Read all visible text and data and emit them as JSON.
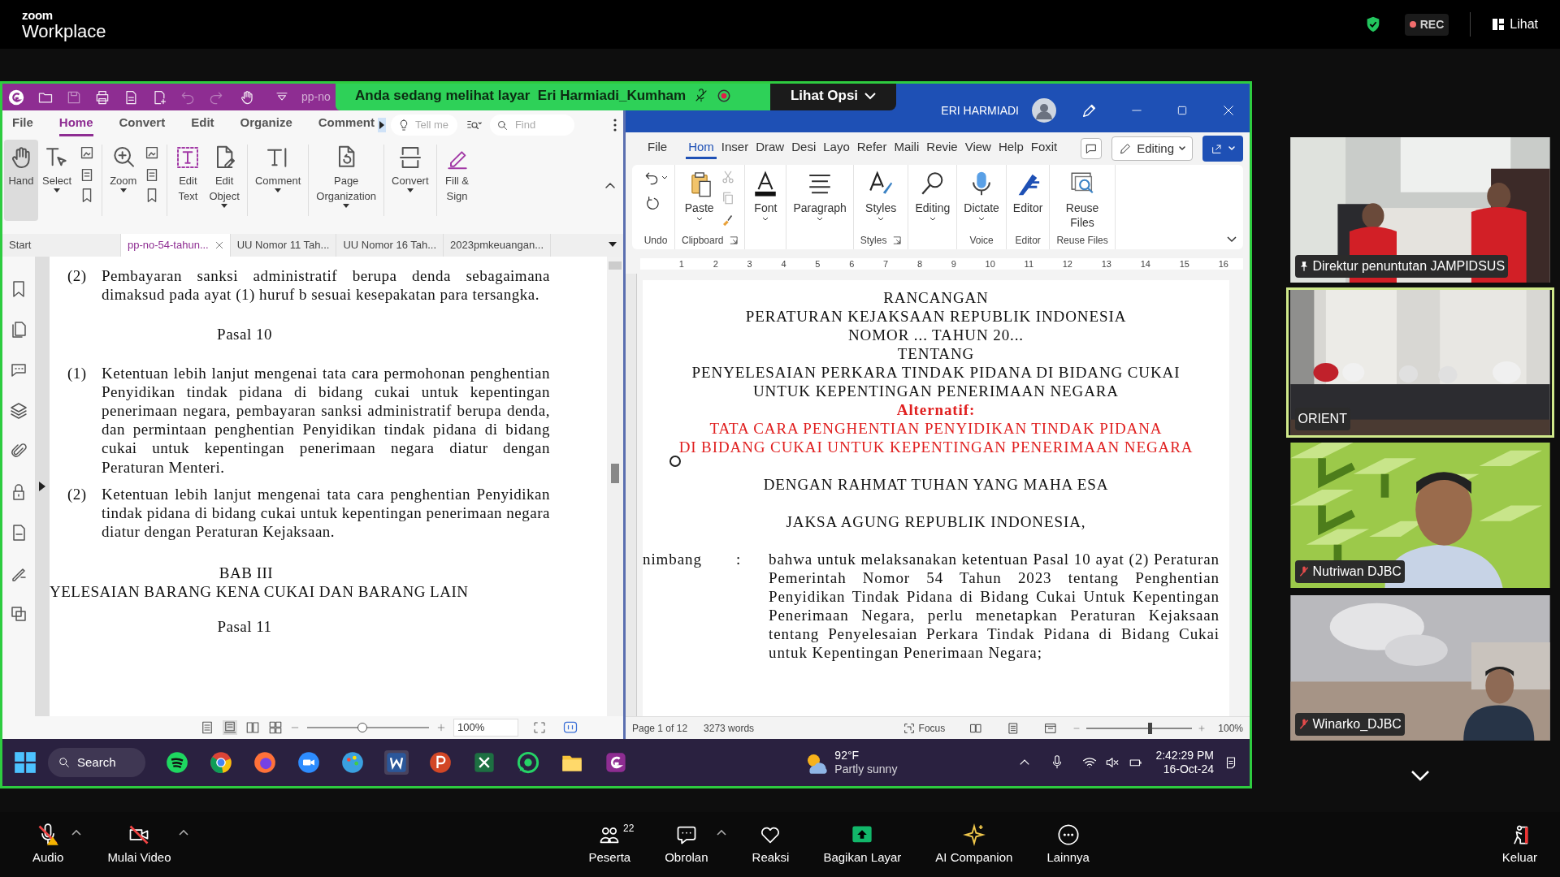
{
  "zoom_header": {
    "logo_top": "zoom",
    "logo_bottom": "Workplace",
    "rec": "REC",
    "view": "Lihat"
  },
  "share_banner": {
    "text": "Anda sedang melihat layar  Eri Harmiadi_Kumham",
    "options": "Lihat Opsi"
  },
  "foxit": {
    "title_fragment": "pp-no",
    "menu": [
      {
        "label": "File",
        "selected": false
      },
      {
        "label": "Home",
        "selected": true
      },
      {
        "label": "Convert",
        "selected": false
      },
      {
        "label": "Edit",
        "selected": false
      },
      {
        "label": "Organize",
        "selected": false
      },
      {
        "label": "Comment",
        "selected": false
      }
    ],
    "tell_me": "Tell me",
    "find": "Find",
    "ribbon": [
      {
        "kind": "big",
        "label": "Hand",
        "selected": true
      },
      {
        "kind": "big",
        "label": "Select",
        "caret": true,
        "selected": false
      },
      {
        "kind": "icon-stack"
      },
      {
        "kind": "big",
        "label": "Zoom",
        "caret": true,
        "selected": false
      },
      {
        "kind": "icon-stack"
      },
      {
        "kind": "big",
        "label": "Edit\nText",
        "selected": false
      },
      {
        "kind": "big",
        "label": "Edit\nObject",
        "caret": true,
        "selected": false
      },
      {
        "kind": "big",
        "label": "Comment",
        "caret": true,
        "selected": false
      },
      {
        "kind": "big",
        "label": "Page\nOrganization",
        "caret": true,
        "selected": false
      },
      {
        "kind": "big",
        "label": "Convert",
        "caret": true,
        "selected": false
      },
      {
        "kind": "big",
        "label": "Fill &\nSign",
        "selected": false
      }
    ],
    "tabs": [
      {
        "label": "Start",
        "selected": false
      },
      {
        "label": "pp-no-54-tahun...",
        "selected": true
      },
      {
        "label": "UU Nomor 11 Tah...",
        "selected": false
      },
      {
        "label": "UU Nomor 16 Tah...",
        "selected": false
      },
      {
        "label": "2023pmkeuangan...",
        "selected": false
      }
    ],
    "doc": [
      {
        "kind": "item",
        "num": "(2)",
        "text": "Pembayaran sanksi administratif berupa denda sebagaimana dimaksud pada ayat (1) huruf b sesuai kesepakatan para tersangka."
      },
      {
        "kind": "heading",
        "text": "Pasal 10"
      },
      {
        "kind": "item",
        "num": "(1)",
        "text": "Ketentuan lebih lanjut mengenai tata cara permohonan penghentian Penyidikan tindak pidana di bidang cukai untuk kepentingan penerimaan negara, pembayaran sanksi administratif berupa denda, dan permintaan penghentian Penyidikan tindak pidana di bidang cukai untuk kepentingan penerimaan negara diatur dengan Peraturan Menteri."
      },
      {
        "kind": "item",
        "num": "(2)",
        "text": "Ketentuan lebih lanjut mengenai tata cara penghentian Penyidikan tindak pidana di bidang cukai untuk kepentingan penerimaan negara diatur dengan Peraturan Kejaksaan."
      },
      {
        "kind": "chapter",
        "text": "BAB III"
      },
      {
        "kind": "chapter-title",
        "text": "YELESAIAN BARANG KENA CUKAI DAN BARANG LAIN"
      },
      {
        "kind": "heading",
        "text": "Pasal 11"
      }
    ],
    "status": {
      "zoom": "100%",
      "level": 0.45
    }
  },
  "word": {
    "user": "ERI HARMIADI",
    "menu": [
      {
        "label": "File",
        "selected": false
      },
      {
        "label": "Hom",
        "selected": true
      },
      {
        "label": "Inser",
        "selected": false
      },
      {
        "label": "Draw",
        "selected": false
      },
      {
        "label": "Desi",
        "selected": false
      },
      {
        "label": "Layo",
        "selected": false
      },
      {
        "label": "Refer",
        "selected": false
      },
      {
        "label": "Maili",
        "selected": false
      },
      {
        "label": "Revie",
        "selected": false
      },
      {
        "label": "View",
        "selected": false
      },
      {
        "label": "Help",
        "selected": false
      },
      {
        "label": "Foxit",
        "selected": false
      }
    ],
    "editing": "Editing",
    "groups": [
      {
        "kind": "undo",
        "label": "Undo"
      },
      {
        "kind": "clipboard",
        "label": "Clipboard",
        "launcher": true,
        "buttons": [
          {
            "kind": "paste",
            "label": "Paste",
            "caret": true
          }
        ]
      },
      {
        "kind": "plain",
        "buttons": [
          {
            "kind": "font",
            "label": "Font",
            "caret": true
          }
        ]
      },
      {
        "kind": "plain",
        "buttons": [
          {
            "kind": "paragraph",
            "label": "Paragraph",
            "caret": true
          }
        ]
      },
      {
        "kind": "plain",
        "label": "Styles",
        "launcher": true,
        "buttons": [
          {
            "kind": "styles",
            "label": "Styles",
            "caret": true
          }
        ]
      },
      {
        "kind": "plain",
        "buttons": [
          {
            "kind": "search",
            "label": "Editing",
            "caret": true
          }
        ]
      },
      {
        "kind": "plain",
        "label": "Voice",
        "buttons": [
          {
            "kind": "mic",
            "label": "Dictate",
            "caret": true
          }
        ]
      },
      {
        "kind": "plain",
        "label": "Editor",
        "buttons": [
          {
            "kind": "editor",
            "label": "Editor"
          }
        ]
      },
      {
        "kind": "plain",
        "label": "Reuse Files",
        "buttons": [
          {
            "kind": "reuse",
            "label": "Reuse\nFiles"
          }
        ]
      }
    ],
    "ruler": [
      "1",
      "2",
      "3",
      "4",
      "5",
      "6",
      "7",
      "8",
      "9",
      "10",
      "11",
      "12",
      "13",
      "14",
      "15",
      "16"
    ],
    "doc": {
      "title_lines": [
        "RANCANGAN",
        "PERATURAN KEJAKSAAN REPUBLIK INDONESIA",
        "NOMOR ... TAHUN 20...",
        "TENTANG",
        "PENYELESAIAN PERKARA TINDAK PIDANA DI BIDANG CUKAI",
        "UNTUK KEPENTINGAN PENERIMAAN NEGARA"
      ],
      "alt_label": "Alternatif:",
      "alt_lines": [
        "TATA CARA PENGHENTIAN PENYIDIKAN TINDAK PIDANA",
        "DI BIDANG CUKAI UNTUK KEPENTINGAN PENERIMAAN NEGARA"
      ],
      "blessing": "DENGAN RAHMAT TUHAN YANG MAHA ESA",
      "issuer": "JAKSA AGUNG REPUBLIK INDONESIA,",
      "consider": {
        "label": "nimbang",
        "sep": ":",
        "text": "bahwa untuk melaksanakan ketentuan Pasal 10 ayat (2) Peraturan Pemerintah Nomor 54 Tahun 2023 tentang Penghentian Penyidikan Tindak Pidana di Bidang Cukai Untuk Kepentingan Penerimaan Negara, perlu menetapkan Peraturan Kejaksaan tentang Penyelesaian Perkara Tindak Pidana di Bidang Cukai untuk Kepentingan Penerimaan Negara;"
      }
    },
    "status": {
      "page": "Page 1 of 12",
      "words": "3273 words",
      "focus": "Focus",
      "zoom": "100%",
      "level": 0.6
    }
  },
  "taskbar": {
    "search": "Search",
    "temp": "92°F",
    "weather": "Partly sunny",
    "time": "2:42:29 PM",
    "date": "16-Oct-24"
  },
  "participants": [
    {
      "name": "Direktur penuntutan JAMPIDSUS",
      "pinned": true,
      "muted": false,
      "selected": false
    },
    {
      "name": "ORIENT",
      "pinned": false,
      "muted": false,
      "selected": true
    },
    {
      "name": "Nutriwan DJBC",
      "pinned": false,
      "muted": true,
      "selected": false
    },
    {
      "name": "Winarko_DJBC",
      "pinned": false,
      "muted": true,
      "selected": false
    }
  ],
  "toolbar": [
    {
      "kind": "mic",
      "label": "Audio",
      "muted": true,
      "caret": true
    },
    {
      "kind": "camera",
      "label": "Mulai Video",
      "muted": true,
      "caret": true
    },
    {
      "kind": "people",
      "label": "Peserta",
      "badge": "22",
      "muted": false,
      "caret": false
    },
    {
      "kind": "chat",
      "label": "Obrolan",
      "muted": false,
      "caret": true
    },
    {
      "kind": "heart",
      "label": "Reaksi",
      "muted": false,
      "caret": false
    },
    {
      "kind": "share",
      "label": "Bagikan Layar",
      "muted": false,
      "caret": false
    },
    {
      "kind": "sparkle",
      "label": "AI Companion",
      "muted": false,
      "caret": false
    },
    {
      "kind": "more",
      "label": "Lainnya",
      "muted": false,
      "caret": false
    },
    {
      "kind": "leave",
      "label": "Keluar",
      "muted": false,
      "caret": false
    }
  ]
}
